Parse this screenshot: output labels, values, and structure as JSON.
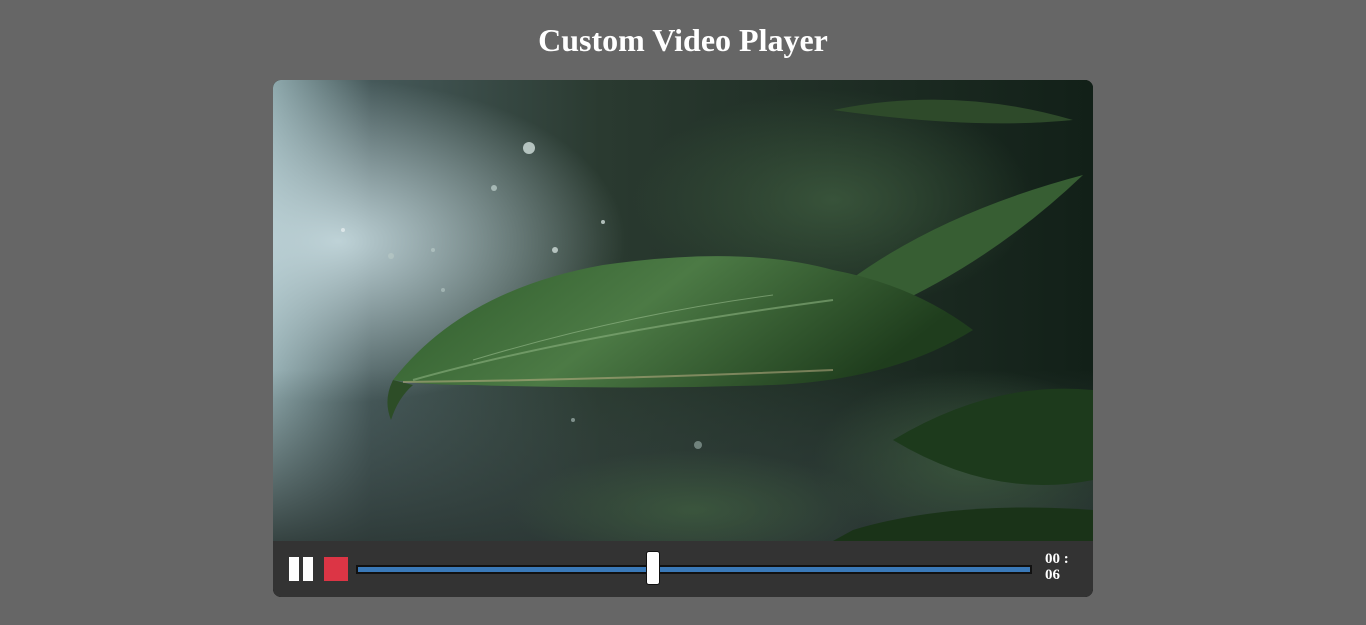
{
  "page": {
    "title": "Custom Video Player"
  },
  "player": {
    "controls": {
      "play_state": "playing",
      "pause_icon": "pause-icon",
      "stop_icon": "stop-icon",
      "progress_fraction": 0.44,
      "time_label": "00 : 06"
    }
  },
  "colors": {
    "page_background": "#666666",
    "controls_background": "#333333",
    "progress_fill": "#3a79b8",
    "stop_button": "#dc3545",
    "text": "#ffffff"
  }
}
